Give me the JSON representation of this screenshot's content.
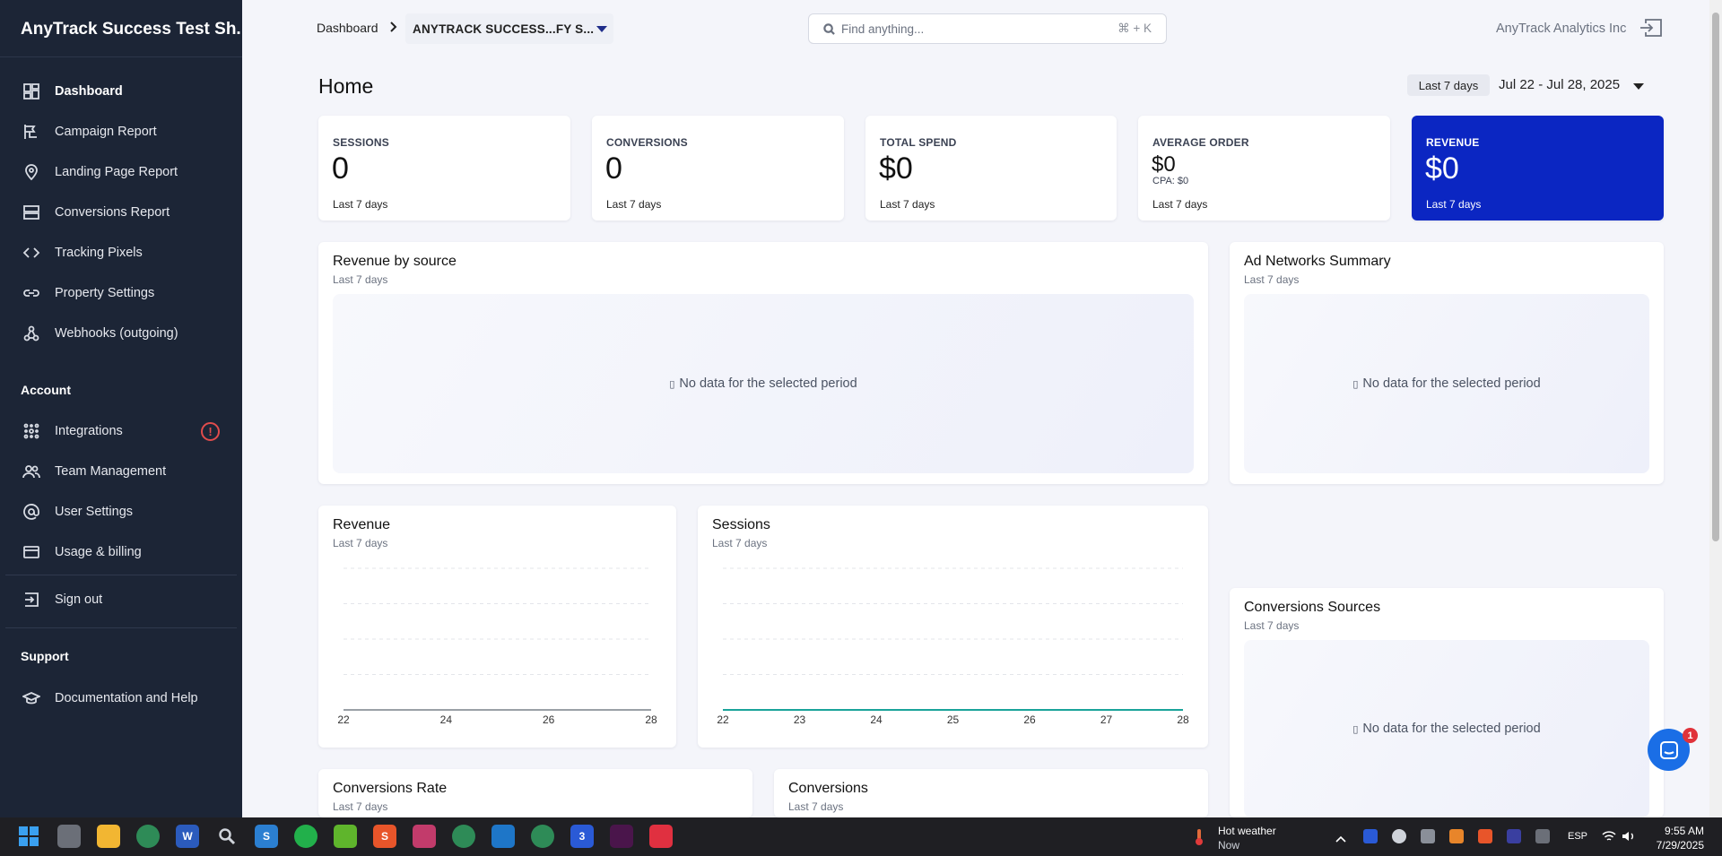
{
  "sidebar": {
    "brand": "AnyTrack Success Test Sh...",
    "items": [
      {
        "label": "Dashboard"
      },
      {
        "label": "Campaign Report"
      },
      {
        "label": "Landing Page Report"
      },
      {
        "label": "Conversions Report"
      },
      {
        "label": "Tracking Pixels"
      },
      {
        "label": "Property Settings"
      },
      {
        "label": "Webhooks (outgoing)"
      }
    ],
    "account_heading": "Account",
    "account_items": [
      {
        "label": "Integrations",
        "badge": "!"
      },
      {
        "label": "Team Management"
      },
      {
        "label": "User Settings"
      },
      {
        "label": "Usage & billing"
      }
    ],
    "signout": "Sign out",
    "support_heading": "Support",
    "support_items": [
      {
        "label": "Documentation and Help"
      }
    ]
  },
  "topbar": {
    "breadcrumb": "Dashboard",
    "property": "ANYTRACK SUCCESS...FY S...",
    "search_placeholder": "Find anything...",
    "search_shortcut": "⌘ + K",
    "org_name": "AnyTrack Analytics Inc"
  },
  "page": {
    "title": "Home",
    "range_chip": "Last 7 days",
    "range_text": "Jul 22  -  Jul 28, 2025"
  },
  "kpis": [
    {
      "label": "SESSIONS",
      "value": "0",
      "period": "Last 7 days"
    },
    {
      "label": "CONVERSIONS",
      "value": "0",
      "period": "Last 7 days"
    },
    {
      "label": "TOTAL SPEND",
      "value": "$0",
      "period": "Last 7 days"
    },
    {
      "label": "AVERAGE ORDER",
      "value": "$0",
      "sub": "CPA: $0",
      "period": "Last 7 days"
    },
    {
      "label": "REVENUE",
      "value": "$0",
      "period": "Last 7 days"
    }
  ],
  "panels": {
    "revenue_by_source": {
      "title": "Revenue by source",
      "sub": "Last 7 days",
      "empty": "No data for the selected period"
    },
    "ad_networks": {
      "title": "Ad Networks Summary",
      "sub": "Last 7 days",
      "empty": "No data for the selected period"
    },
    "revenue": {
      "title": "Revenue",
      "sub": "Last 7 days"
    },
    "sessions": {
      "title": "Sessions",
      "sub": "Last 7 days"
    },
    "conversion_sources": {
      "title": "Conversions Sources",
      "sub": "Last 7 days",
      "empty": "No data for the selected period"
    },
    "conversions_rate": {
      "title": "Conversions Rate",
      "sub": "Last 7 days"
    },
    "conversions": {
      "title": "Conversions",
      "sub": "Last 7 days"
    }
  },
  "chart_data": [
    {
      "type": "line",
      "name": "revenue",
      "x": [
        "22",
        "24",
        "26",
        "28"
      ],
      "values": [
        0,
        0,
        0,
        0
      ],
      "color": "#9aa0a6"
    },
    {
      "type": "line",
      "name": "sessions",
      "x": [
        "22",
        "23",
        "24",
        "25",
        "26",
        "27",
        "28"
      ],
      "values": [
        0,
        0,
        0,
        0,
        0,
        0,
        0
      ],
      "color": "#1aa39a"
    }
  ],
  "chat": {
    "badge": "1"
  },
  "taskbar": {
    "weather_title": "Hot weather",
    "weather_sub": "Now",
    "lang": "ESP",
    "time": "9:55 AM",
    "date": "7/29/2025",
    "zoom_badge": "3"
  },
  "colors": {
    "sidebar": "#1c2536",
    "accent": "#0b26c2",
    "sessions_line": "#1aa39a"
  }
}
